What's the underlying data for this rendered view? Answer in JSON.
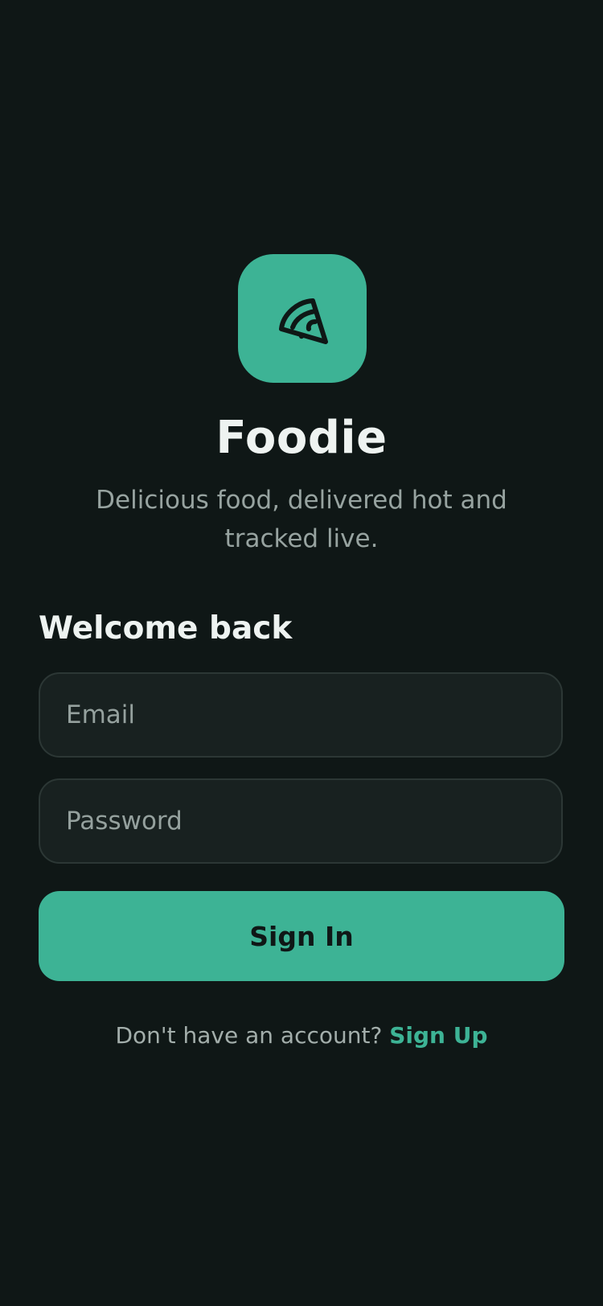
{
  "app": {
    "title": "Foodie",
    "tagline": "Delicious food, delivered hot and tracked live.",
    "logo_icon": "pizza-slice-icon"
  },
  "form": {
    "heading": "Welcome back",
    "email": {
      "value": "",
      "placeholder": "Email"
    },
    "password": {
      "value": "",
      "placeholder": "Password"
    },
    "submit_label": "Sign In"
  },
  "footer": {
    "prompt": "Don't have an account?",
    "link_label": "Sign Up"
  },
  "colors": {
    "background": "#0f1716",
    "accent": "#3db395",
    "field_background": "#182120",
    "field_border": "#2c3735",
    "text_primary": "#eef3f1",
    "text_secondary": "#97a3a0"
  }
}
